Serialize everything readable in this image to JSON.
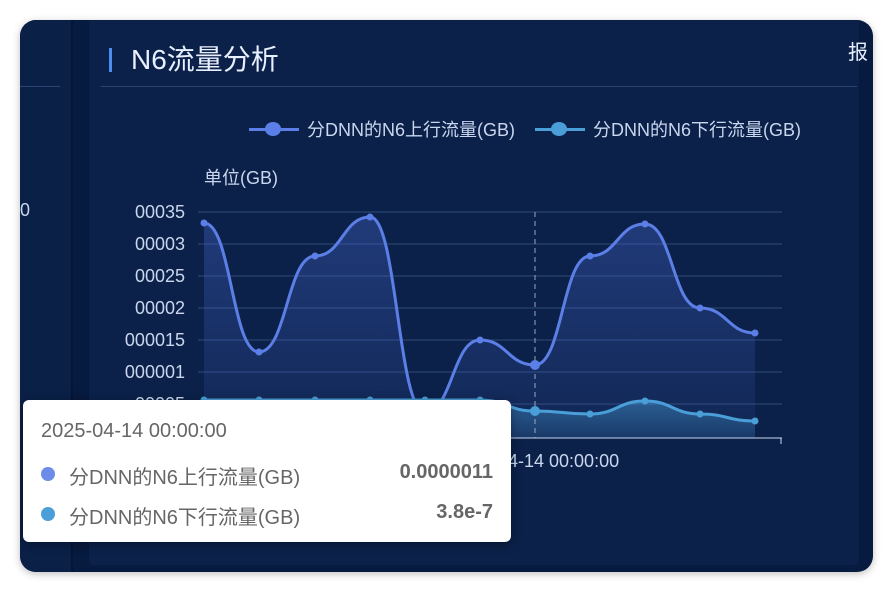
{
  "panel": {
    "title": "N6流量分析",
    "right_partial_text": "报",
    "left_partial_value": "0"
  },
  "chart_data": {
    "type": "line",
    "unit_label": "单位(GB)",
    "series": [
      {
        "name": "分DNN的N6上行流量(GB)",
        "color": "#5b7fe6",
        "values": [
          0.00033,
          1.3e-05,
          2.8e-05,
          3.4e-05,
          3e-06,
          1.5e-05,
          1.1e-06,
          2.8e-05,
          3.3e-05,
          2e-05,
          1.6e-05
        ]
      },
      {
        "name": "分DNN的N6下行流量(GB)",
        "color": "#4a9fd8",
        "values": [
          5e-07,
          5e-07,
          5e-07,
          5e-07,
          5e-07,
          5e-07,
          3.8e-07,
          3.5e-07,
          5.5e-07,
          3.5e-07,
          2.5e-07
        ]
      }
    ],
    "y_ticks": [
      "00035",
      "00003",
      "00025",
      "00002",
      "000015",
      "000001",
      "00005"
    ],
    "x_axis_label_partial": "4-14 00:00:00",
    "grid": true,
    "legend_position": "top-center"
  },
  "tooltip": {
    "title": "2025-04-14 00:00:00",
    "rows": [
      {
        "name": "分DNN的N6上行流量(GB)",
        "value": "0.0000011",
        "color": "#6b8ce8"
      },
      {
        "name": "分DNN的N6下行流量(GB)",
        "value": "3.8e-7",
        "color": "#4a9fd8"
      }
    ]
  }
}
